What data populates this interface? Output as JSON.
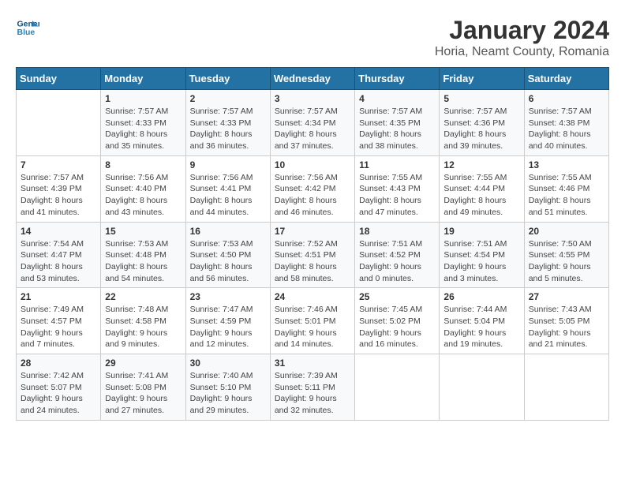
{
  "header": {
    "logo_line1": "General",
    "logo_line2": "Blue",
    "title": "January 2024",
    "subtitle": "Horia, Neamt County, Romania"
  },
  "days_of_week": [
    "Sunday",
    "Monday",
    "Tuesday",
    "Wednesday",
    "Thursday",
    "Friday",
    "Saturday"
  ],
  "weeks": [
    [
      {
        "num": "",
        "info": ""
      },
      {
        "num": "1",
        "info": "Sunrise: 7:57 AM\nSunset: 4:33 PM\nDaylight: 8 hours\nand 35 minutes."
      },
      {
        "num": "2",
        "info": "Sunrise: 7:57 AM\nSunset: 4:33 PM\nDaylight: 8 hours\nand 36 minutes."
      },
      {
        "num": "3",
        "info": "Sunrise: 7:57 AM\nSunset: 4:34 PM\nDaylight: 8 hours\nand 37 minutes."
      },
      {
        "num": "4",
        "info": "Sunrise: 7:57 AM\nSunset: 4:35 PM\nDaylight: 8 hours\nand 38 minutes."
      },
      {
        "num": "5",
        "info": "Sunrise: 7:57 AM\nSunset: 4:36 PM\nDaylight: 8 hours\nand 39 minutes."
      },
      {
        "num": "6",
        "info": "Sunrise: 7:57 AM\nSunset: 4:38 PM\nDaylight: 8 hours\nand 40 minutes."
      }
    ],
    [
      {
        "num": "7",
        "info": "Sunrise: 7:57 AM\nSunset: 4:39 PM\nDaylight: 8 hours\nand 41 minutes."
      },
      {
        "num": "8",
        "info": "Sunrise: 7:56 AM\nSunset: 4:40 PM\nDaylight: 8 hours\nand 43 minutes."
      },
      {
        "num": "9",
        "info": "Sunrise: 7:56 AM\nSunset: 4:41 PM\nDaylight: 8 hours\nand 44 minutes."
      },
      {
        "num": "10",
        "info": "Sunrise: 7:56 AM\nSunset: 4:42 PM\nDaylight: 8 hours\nand 46 minutes."
      },
      {
        "num": "11",
        "info": "Sunrise: 7:55 AM\nSunset: 4:43 PM\nDaylight: 8 hours\nand 47 minutes."
      },
      {
        "num": "12",
        "info": "Sunrise: 7:55 AM\nSunset: 4:44 PM\nDaylight: 8 hours\nand 49 minutes."
      },
      {
        "num": "13",
        "info": "Sunrise: 7:55 AM\nSunset: 4:46 PM\nDaylight: 8 hours\nand 51 minutes."
      }
    ],
    [
      {
        "num": "14",
        "info": "Sunrise: 7:54 AM\nSunset: 4:47 PM\nDaylight: 8 hours\nand 53 minutes."
      },
      {
        "num": "15",
        "info": "Sunrise: 7:53 AM\nSunset: 4:48 PM\nDaylight: 8 hours\nand 54 minutes."
      },
      {
        "num": "16",
        "info": "Sunrise: 7:53 AM\nSunset: 4:50 PM\nDaylight: 8 hours\nand 56 minutes."
      },
      {
        "num": "17",
        "info": "Sunrise: 7:52 AM\nSunset: 4:51 PM\nDaylight: 8 hours\nand 58 minutes."
      },
      {
        "num": "18",
        "info": "Sunrise: 7:51 AM\nSunset: 4:52 PM\nDaylight: 9 hours\nand 0 minutes."
      },
      {
        "num": "19",
        "info": "Sunrise: 7:51 AM\nSunset: 4:54 PM\nDaylight: 9 hours\nand 3 minutes."
      },
      {
        "num": "20",
        "info": "Sunrise: 7:50 AM\nSunset: 4:55 PM\nDaylight: 9 hours\nand 5 minutes."
      }
    ],
    [
      {
        "num": "21",
        "info": "Sunrise: 7:49 AM\nSunset: 4:57 PM\nDaylight: 9 hours\nand 7 minutes."
      },
      {
        "num": "22",
        "info": "Sunrise: 7:48 AM\nSunset: 4:58 PM\nDaylight: 9 hours\nand 9 minutes."
      },
      {
        "num": "23",
        "info": "Sunrise: 7:47 AM\nSunset: 4:59 PM\nDaylight: 9 hours\nand 12 minutes."
      },
      {
        "num": "24",
        "info": "Sunrise: 7:46 AM\nSunset: 5:01 PM\nDaylight: 9 hours\nand 14 minutes."
      },
      {
        "num": "25",
        "info": "Sunrise: 7:45 AM\nSunset: 5:02 PM\nDaylight: 9 hours\nand 16 minutes."
      },
      {
        "num": "26",
        "info": "Sunrise: 7:44 AM\nSunset: 5:04 PM\nDaylight: 9 hours\nand 19 minutes."
      },
      {
        "num": "27",
        "info": "Sunrise: 7:43 AM\nSunset: 5:05 PM\nDaylight: 9 hours\nand 21 minutes."
      }
    ],
    [
      {
        "num": "28",
        "info": "Sunrise: 7:42 AM\nSunset: 5:07 PM\nDaylight: 9 hours\nand 24 minutes."
      },
      {
        "num": "29",
        "info": "Sunrise: 7:41 AM\nSunset: 5:08 PM\nDaylight: 9 hours\nand 27 minutes."
      },
      {
        "num": "30",
        "info": "Sunrise: 7:40 AM\nSunset: 5:10 PM\nDaylight: 9 hours\nand 29 minutes."
      },
      {
        "num": "31",
        "info": "Sunrise: 7:39 AM\nSunset: 5:11 PM\nDaylight: 9 hours\nand 32 minutes."
      },
      {
        "num": "",
        "info": ""
      },
      {
        "num": "",
        "info": ""
      },
      {
        "num": "",
        "info": ""
      }
    ]
  ]
}
